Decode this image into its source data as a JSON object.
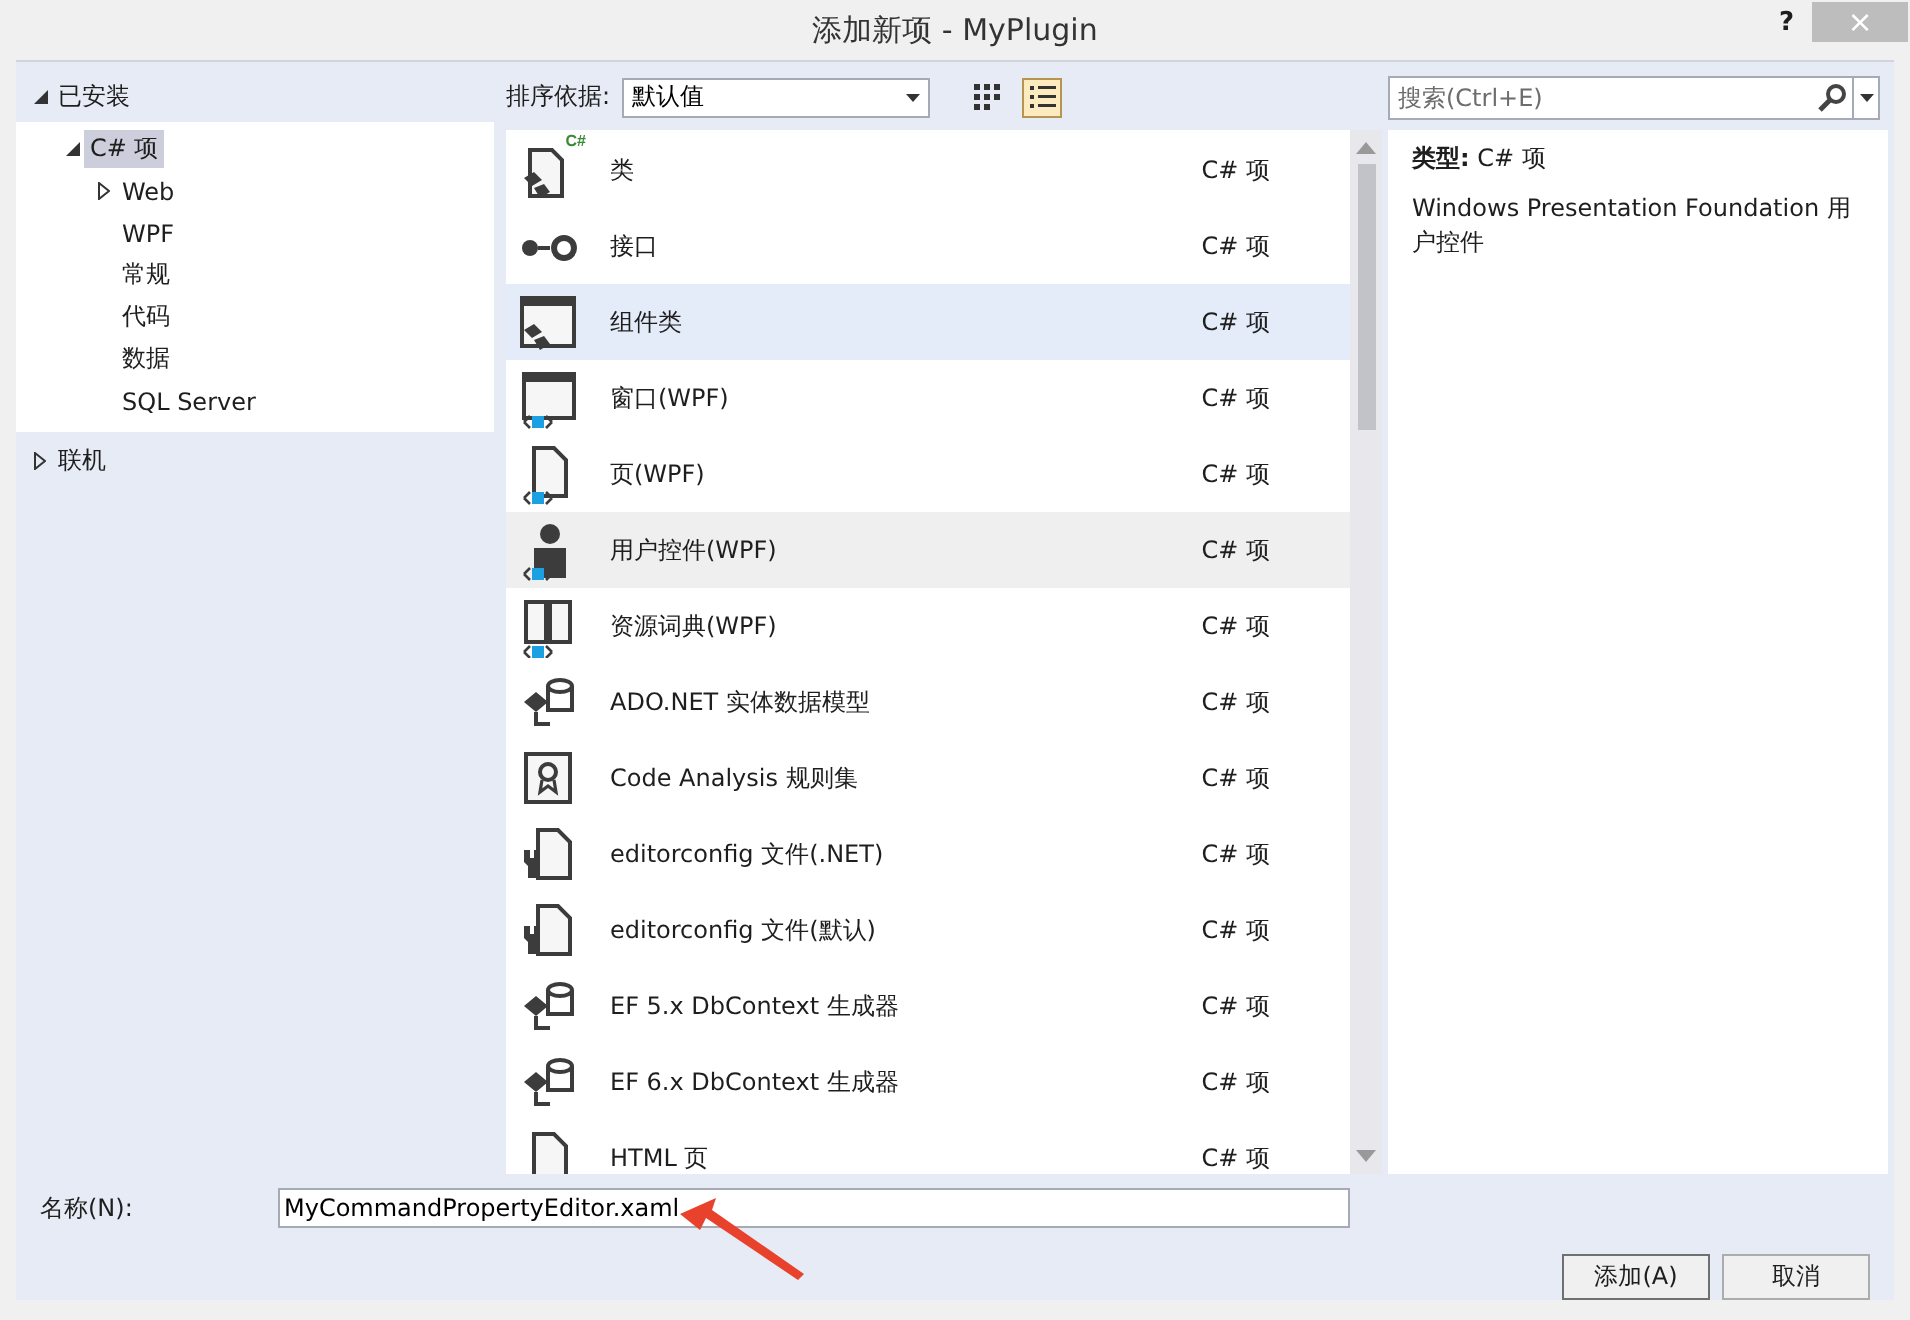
{
  "window": {
    "title": "添加新项 - MyPlugin",
    "help": "?",
    "close": "×"
  },
  "tree": [
    {
      "label": "已安装",
      "expanded": true,
      "selected": false,
      "children": [
        {
          "label": "C# 项",
          "expanded": true,
          "selected": true,
          "children": [
            {
              "label": "Web",
              "expanded": false,
              "selected": false
            },
            {
              "label": "WPF",
              "selected": false
            },
            {
              "label": "常规",
              "selected": false
            },
            {
              "label": "代码",
              "selected": false
            },
            {
              "label": "数据",
              "selected": false
            },
            {
              "label": "SQL Server",
              "selected": false
            }
          ]
        }
      ]
    },
    {
      "label": "联机",
      "expanded": false,
      "selected": false
    }
  ],
  "sort": {
    "label": "排序依据:",
    "value": "默认值"
  },
  "view_buttons": [
    {
      "kind": "grid",
      "selected": false
    },
    {
      "kind": "list",
      "selected": true
    }
  ],
  "search": {
    "placeholder": "搜索(Ctrl+E)"
  },
  "items": [
    {
      "kind": "class",
      "badge": "C#",
      "name": "类",
      "type": "C# 项",
      "selected": false,
      "hovered": false
    },
    {
      "kind": "interface",
      "name": "接口",
      "type": "C# 项",
      "selected": false,
      "hovered": false
    },
    {
      "kind": "component",
      "name": "组件类",
      "type": "C# 项",
      "selected": false,
      "hovered": true
    },
    {
      "kind": "window",
      "name": "窗口(WPF)",
      "type": "C# 项",
      "selected": false,
      "hovered": false
    },
    {
      "kind": "page",
      "name": "页(WPF)",
      "type": "C# 项",
      "selected": false,
      "hovered": false
    },
    {
      "kind": "usercontrol",
      "name": "用户控件(WPF)",
      "type": "C# 项",
      "selected": true,
      "hovered": false
    },
    {
      "kind": "dictionary",
      "name": "资源词典(WPF)",
      "type": "C# 项",
      "selected": false,
      "hovered": false
    },
    {
      "kind": "model",
      "name": "ADO.NET 实体数据模型",
      "type": "C# 项",
      "selected": false,
      "hovered": false
    },
    {
      "kind": "ruleset",
      "name": "Code Analysis 规则集",
      "type": "C# 项",
      "selected": false,
      "hovered": false
    },
    {
      "kind": "config",
      "name": "editorconfig 文件(.NET)",
      "type": "C# 项",
      "selected": false,
      "hovered": false
    },
    {
      "kind": "config",
      "name": "editorconfig 文件(默认)",
      "type": "C# 项",
      "selected": false,
      "hovered": false
    },
    {
      "kind": "model",
      "name": "EF 5.x DbContext 生成器",
      "type": "C# 项",
      "selected": false,
      "hovered": false
    },
    {
      "kind": "model",
      "name": "EF 6.x DbContext 生成器",
      "type": "C# 项",
      "selected": false,
      "hovered": false
    },
    {
      "kind": "file",
      "name": "HTML 页",
      "type": "C# 项",
      "selected": false,
      "hovered": false
    }
  ],
  "details": {
    "type_label": "类型:",
    "type_value": "C# 项",
    "description": "Windows Presentation Foundation 用户控件"
  },
  "name_field": {
    "label": "名称(N):",
    "value": "MyCommandPropertyEditor.xaml"
  },
  "buttons": [
    {
      "label": "添加(A)",
      "kind": "default"
    },
    {
      "label": "取消",
      "kind": "normal"
    }
  ]
}
